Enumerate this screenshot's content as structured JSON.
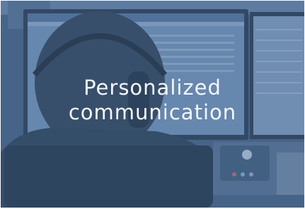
{
  "banner": {
    "caption_line1": "Personalized",
    "caption_line2": "communication"
  },
  "colors": {
    "tint": "#3f608a",
    "text": "#f4f7fb"
  }
}
